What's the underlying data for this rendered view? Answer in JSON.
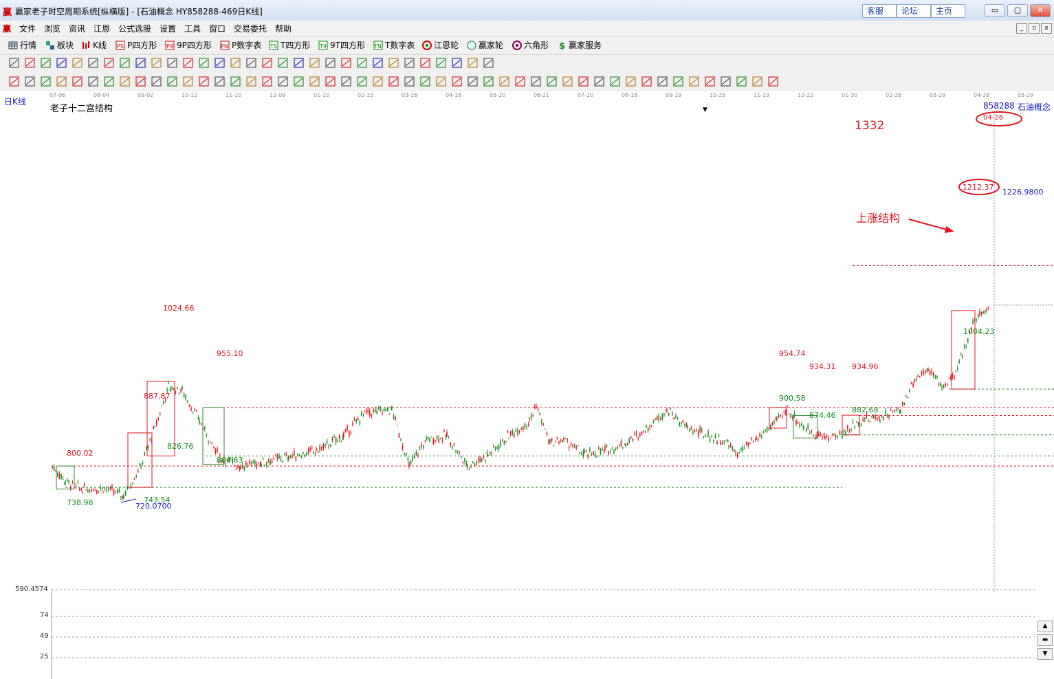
{
  "window": {
    "title": "赢家老子时空周期系统[纵横版] - [石油概念  HY858288-469日K线]",
    "links": [
      "客服",
      "论坛",
      "主页"
    ],
    "controls": [
      "▭",
      "▢",
      "✕"
    ]
  },
  "menu": [
    "文件",
    "浏览",
    "资讯",
    "江恩",
    "公式选股",
    "设置",
    "工具",
    "窗口",
    "交易委托",
    "帮助"
  ],
  "toolbar1": [
    "行情",
    "板块",
    "K线",
    "P四方形",
    "9P四方形",
    "P数字表",
    "T四方形",
    "9T四方形",
    "T数字表",
    "江恩轮",
    "赢家轮",
    "六角形",
    "赢家服务"
  ],
  "chart": {
    "period_label": "日K线",
    "indicator_name": "老子十二宫结构",
    "code": "858288",
    "name": "石油概念",
    "date_ticks": [
      "07-06",
      "08-04",
      "09-02",
      "10-12",
      "11-10",
      "12-09",
      "01-10",
      "02-15",
      "03-16",
      "04-18",
      "05-20",
      "06-21",
      "07-20",
      "08-18",
      "09-19",
      "10-25",
      "11-23",
      "12-22",
      "01-30",
      "02-28",
      "03-29",
      "04-28",
      "05-29"
    ],
    "target_value": "1332",
    "target_date": "04-26",
    "cursor_price": "1226.9800",
    "axis_min_label": "590.4574",
    "lower_axis_ticks": [
      "74",
      "49",
      "25"
    ],
    "low_mark": "720.0700",
    "annotation_text": "上涨结构",
    "levels": [
      "800.02",
      "738.98",
      "743.54",
      "887.87",
      "826.76",
      "1024.66",
      "955.10",
      "804.63",
      "954.74",
      "934.31",
      "900.58",
      "874.46",
      "934.96",
      "882.68",
      "1212.37",
      "1004.23"
    ],
    "colors": {
      "up": "#e0141e",
      "down": "#128c1c",
      "support": "#2a8a2a",
      "resistance": "#e0141e",
      "blue": "#1515c8"
    }
  }
}
